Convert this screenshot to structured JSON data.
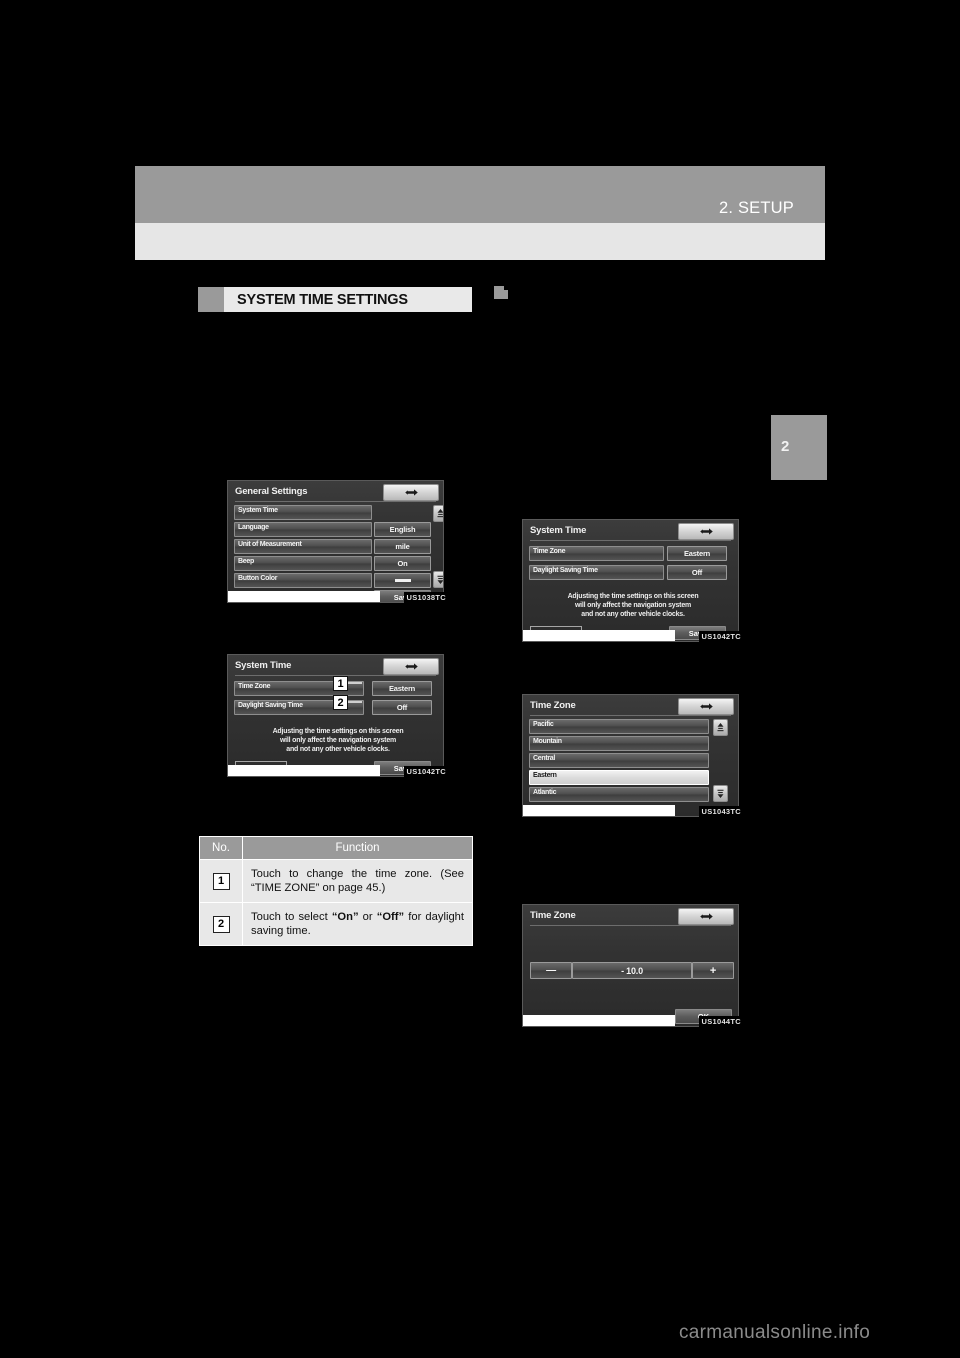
{
  "header": {
    "title": "2. SETUP",
    "chapter_tab": "2"
  },
  "section": {
    "heading": "SYSTEM TIME SETTINGS"
  },
  "watermark": "carmanualsonline.info",
  "screens": {
    "general_settings": {
      "caption": "US1038TC",
      "title": "General Settings",
      "back_icon": "back-arrow-icon",
      "rows": [
        {
          "label": "System Time",
          "value": ""
        },
        {
          "label": "Language",
          "value": "English"
        },
        {
          "label": "Unit of Measurement",
          "value": "mile"
        },
        {
          "label": "Beep",
          "value": "On"
        },
        {
          "label": "Button Color",
          "value": "color-bar"
        }
      ],
      "save_label": "Save",
      "scroll_up_icon": "scroll-up-icon",
      "scroll_down_icon": "scroll-down-icon"
    },
    "system_time_callouts": {
      "caption": "US1042TC",
      "title": "System Time",
      "back_icon": "back-arrow-icon",
      "rows": [
        {
          "label": "Time Zone",
          "value": "Eastern",
          "callout": "1"
        },
        {
          "label": "Daylight Saving Time",
          "value": "Off",
          "callout": "2"
        }
      ],
      "note": "Adjusting the time settings on this screen will only affect the navigation system and not any other vehicle clocks.",
      "note_lines": [
        "Adjusting the time settings on this screen",
        "will only affect the navigation system",
        "and not any other vehicle clocks."
      ],
      "clock": "- - : - -",
      "save_label": "Save"
    },
    "system_time_plain": {
      "caption": "US1042TC",
      "title": "System Time",
      "back_icon": "back-arrow-icon",
      "rows": [
        {
          "label": "Time Zone",
          "value": "Eastern"
        },
        {
          "label": "Daylight Saving Time",
          "value": "Off"
        }
      ],
      "note_lines": [
        "Adjusting the time settings on this screen",
        "will only affect the navigation system",
        "and not any other vehicle clocks."
      ],
      "clock": "- - : - -",
      "save_label": "Save"
    },
    "time_zone_list": {
      "caption": "US1043TC",
      "title": "Time Zone",
      "back_icon": "back-arrow-icon",
      "items": [
        {
          "label": "Pacific",
          "selected": false
        },
        {
          "label": "Mountain",
          "selected": false
        },
        {
          "label": "Central",
          "selected": false
        },
        {
          "label": "Eastern",
          "selected": true
        },
        {
          "label": "Atlantic",
          "selected": false
        }
      ],
      "scroll_up_icon": "scroll-up-icon",
      "scroll_down_icon": "scroll-down-icon"
    },
    "time_zone_adjust": {
      "caption": "US1044TC",
      "title": "Time Zone",
      "back_icon": "back-arrow-icon",
      "minus_label": "—",
      "value": "- 10.0",
      "plus_label": "+",
      "ok_label": "OK"
    }
  },
  "function_table": {
    "columns": [
      "No.",
      "Function"
    ],
    "rows": [
      {
        "no": "1",
        "function": "Touch to change the time zone. (See “TIME ZONE” on page 45.)"
      },
      {
        "no": "2",
        "function_parts": [
          "Touch to select ",
          "“On”",
          " or ",
          "“Off”",
          " for daylight saving time."
        ]
      }
    ]
  }
}
